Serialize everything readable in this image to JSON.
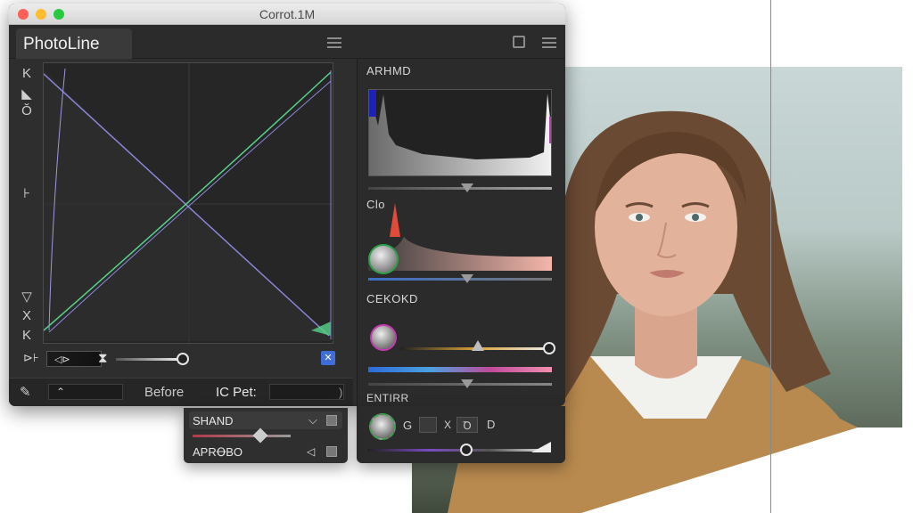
{
  "window": {
    "title": "Corrot.1M"
  },
  "tabs": [
    {
      "label": "PhotoLine"
    }
  ],
  "left_tools": [
    {
      "glyph": "K"
    },
    {
      "glyph": "◣"
    },
    {
      "glyph": "Ŏ"
    },
    {
      "glyph": "⊦"
    },
    {
      "glyph": "▽"
    },
    {
      "glyph": "X"
    },
    {
      "glyph": "K"
    }
  ],
  "curves": {
    "channel_glyph": "⊳⊦",
    "swatch_text": "◁⊳",
    "hourglass": "⧗",
    "blue_button": "✕"
  },
  "bottombar": {
    "brush_icon": "✎",
    "field_text": "⌃",
    "before_label": "Before",
    "preset_label": "IC Pet:",
    "preset_value": "",
    "scroll_glyph": ")"
  },
  "right_panel": {
    "sections": [
      {
        "label": "ARHMD"
      },
      {
        "label": "Clo"
      },
      {
        "label": "CEKOKD"
      },
      {
        "label": "ENTIRR"
      }
    ],
    "entirr_glyphs": [
      "G",
      "X",
      "Ꝺ",
      "D"
    ]
  },
  "subpanel": {
    "title": "SHAND",
    "label": "APRꝊBO",
    "icons": [
      "⌵",
      "◁"
    ]
  },
  "colors": {
    "accent_blue": "#3f6ed8",
    "window_bg": "#2e2e2e",
    "curve_green": "#55d48a",
    "curve_purple": "#8a86d8"
  }
}
